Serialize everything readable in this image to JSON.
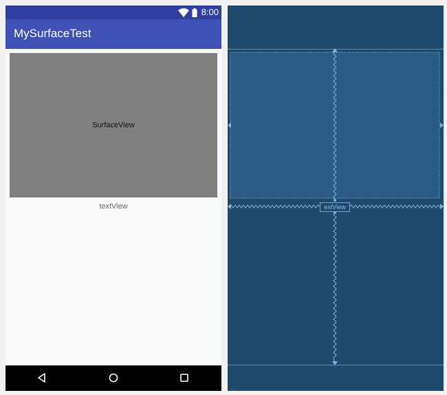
{
  "status_bar": {
    "time": "8:00"
  },
  "app_bar": {
    "title": "MySurfaceTest"
  },
  "content": {
    "surface_view_label": "SurfaceView",
    "text_view_label": "textView"
  },
  "blueprint": {
    "text_view_label": "extView"
  },
  "colors": {
    "status_bar": "#303f9f",
    "app_bar": "#3f51b5",
    "surface_view": "#808080",
    "blueprint_bg": "#204a6b",
    "blueprint_component": "#2b5c86",
    "blueprint_line": "#6fa8d8"
  },
  "icons": {
    "status": [
      "wifi-icon",
      "battery-icon"
    ],
    "navigation": [
      "back-icon",
      "home-icon",
      "recents-icon"
    ]
  }
}
